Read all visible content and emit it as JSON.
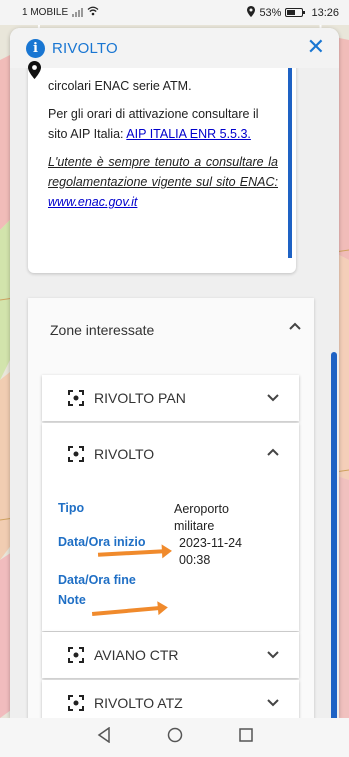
{
  "status_bar": {
    "carrier": "1 MOBILE",
    "battery": "53%",
    "battery_level": 0.53,
    "time": "13:26"
  },
  "panel": {
    "title": "RIVOLTO",
    "close_icon": "close-icon",
    "accent_color": "#1976d2"
  },
  "notes": {
    "line1": "circolari ENAC serie ATM.",
    "line2_text": "Per gli orari di attivazione consultare il sito AIP Italia: ",
    "line2_link": "AIP ITALIA ENR 5.5.3.",
    "line3_text": "L'utente è sempre tenuto a consultare la regolamentazione vigente sul sito ENAC: ",
    "line3_link": "www.enac.gov.it"
  },
  "zones": {
    "header": "Zone interessate",
    "items": [
      {
        "name": "RIVOLTO PAN",
        "expanded": false
      },
      {
        "name": "RIVOLTO",
        "expanded": true
      },
      {
        "name": "AVIANO CTR",
        "expanded": false
      },
      {
        "name": "RIVOLTO ATZ",
        "expanded": false
      }
    ],
    "detail": {
      "tipo_label": "Tipo",
      "tipo_value": "Aeroporto militare",
      "inizio_label": "Data/Ora inizio",
      "inizio_value": "2023-11-24 00:38",
      "fine_label": "Data/Ora fine",
      "note_label": "Note"
    }
  },
  "colors": {
    "label_blue": "#1f6fc5",
    "arrow_orange": "#f08a2c",
    "scrollbar_blue": "#1e62c4"
  }
}
